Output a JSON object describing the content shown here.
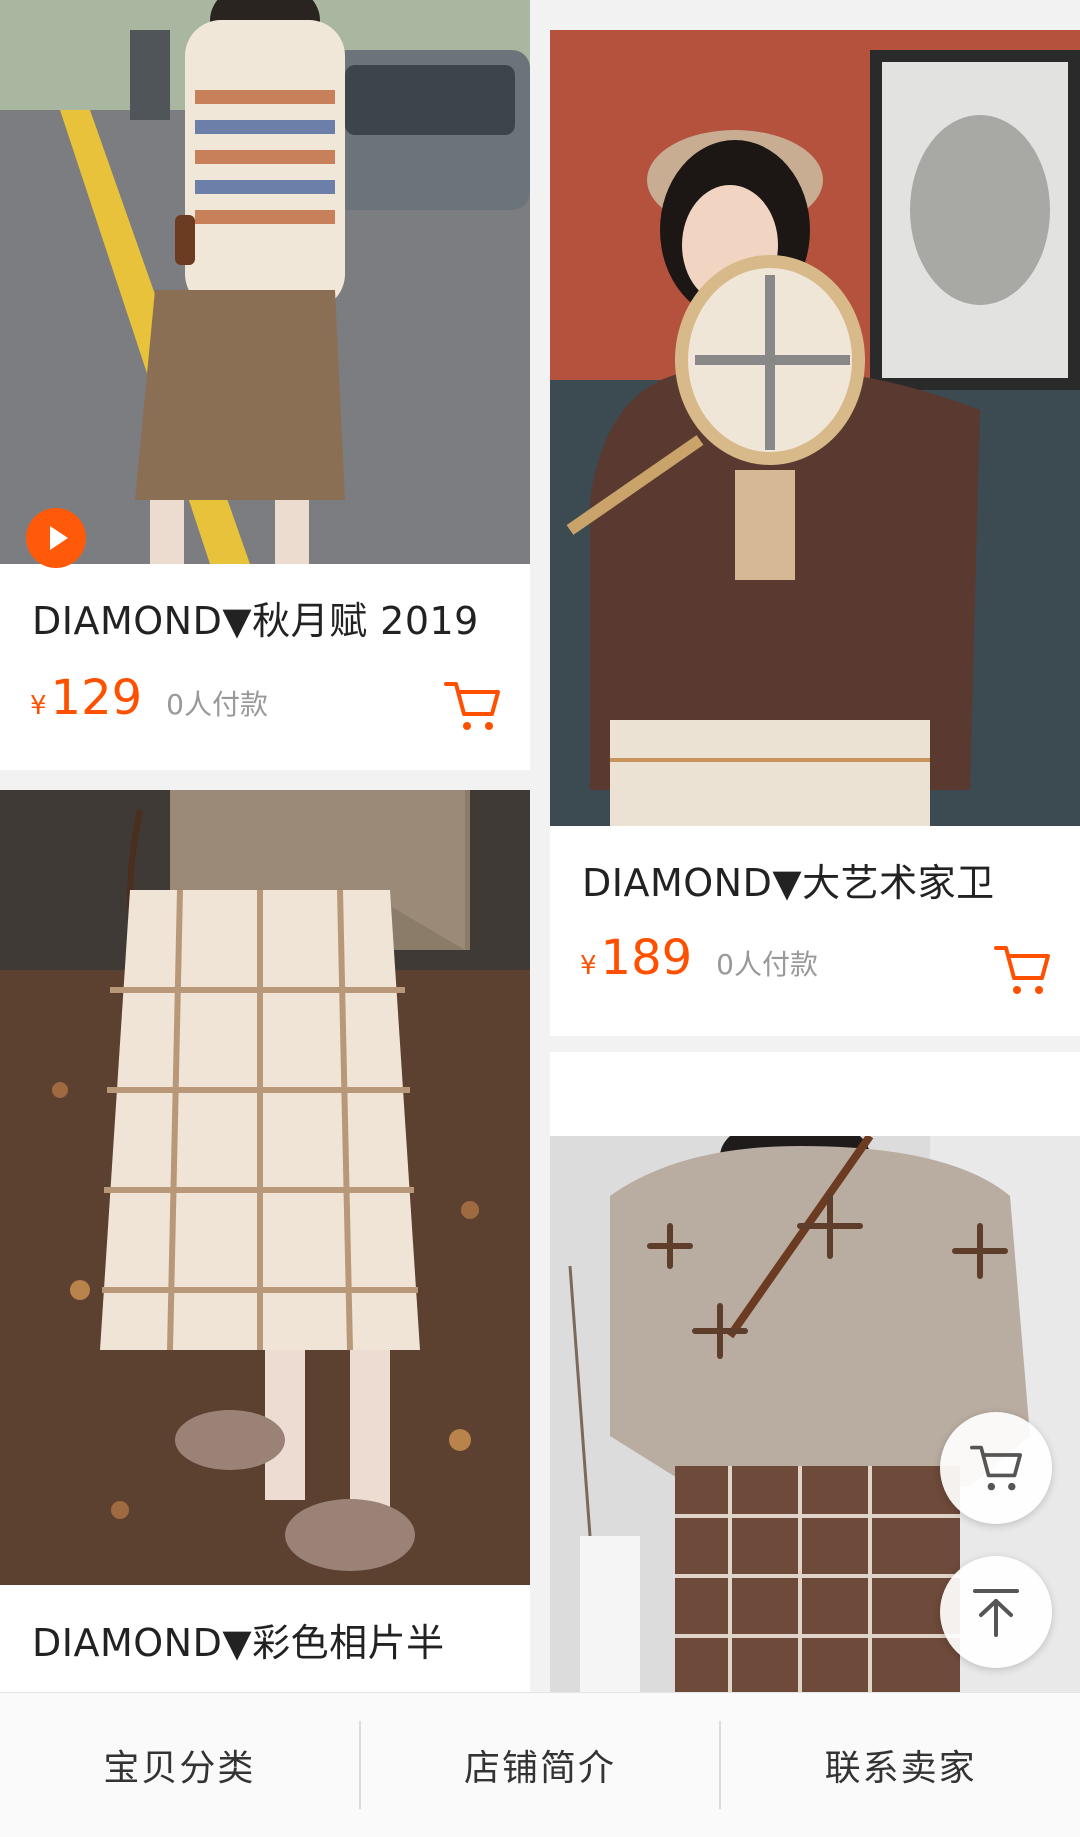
{
  "products": [
    {
      "title": "DIAMOND▼秋月赋 2019",
      "currency": "¥",
      "price": "129",
      "paid": "0人付款",
      "has_video": true
    },
    {
      "title": "DIAMOND▼大艺术家卫",
      "currency": "¥",
      "price": "189",
      "paid": "0人付款",
      "has_video": false
    },
    {
      "title": "DIAMOND▼彩色相片半"
    },
    {
      "title": ""
    }
  ],
  "floating": {
    "cart_icon": "cart-icon",
    "top_icon": "arrow-up-top-icon"
  },
  "bottom_nav": {
    "items": [
      "宝贝分类",
      "店铺简介",
      "联系卖家"
    ]
  },
  "colors": {
    "accent": "#ff5000",
    "play_badge": "#ff5a0a"
  }
}
